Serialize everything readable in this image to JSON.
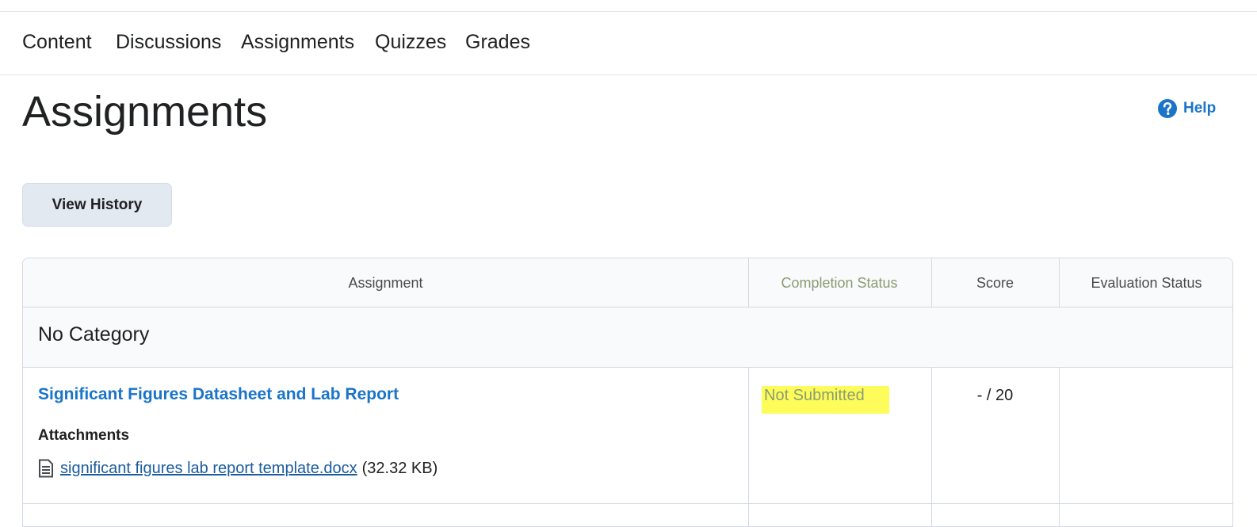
{
  "nav": {
    "items": [
      {
        "label": "Content"
      },
      {
        "label": "Discussions"
      },
      {
        "label": "Assignments"
      },
      {
        "label": "Quizzes"
      },
      {
        "label": "Grades"
      }
    ]
  },
  "page": {
    "title": "Assignments",
    "help_label": "Help",
    "help_icon": "help-circle-icon",
    "view_history_label": "View History"
  },
  "table": {
    "headers": {
      "assignment": "Assignment",
      "completion_status": "Completion Status",
      "score": "Score",
      "evaluation_status": "Evaluation Status"
    },
    "category": "No Category",
    "rows": [
      {
        "title": "Significant Figures Datasheet and Lab Report",
        "attachments_label": "Attachments",
        "attachment": {
          "icon": "document-icon",
          "name": "significant figures lab report template.docx",
          "size": "(32.32 KB)"
        },
        "completion_status": "Not Submitted",
        "score": "- / 20",
        "evaluation_status": ""
      }
    ]
  },
  "colors": {
    "link": "#1a74c8",
    "highlight": "#fdfc5a",
    "button_bg": "#e3e9f1",
    "border": "#d3d9e3"
  }
}
